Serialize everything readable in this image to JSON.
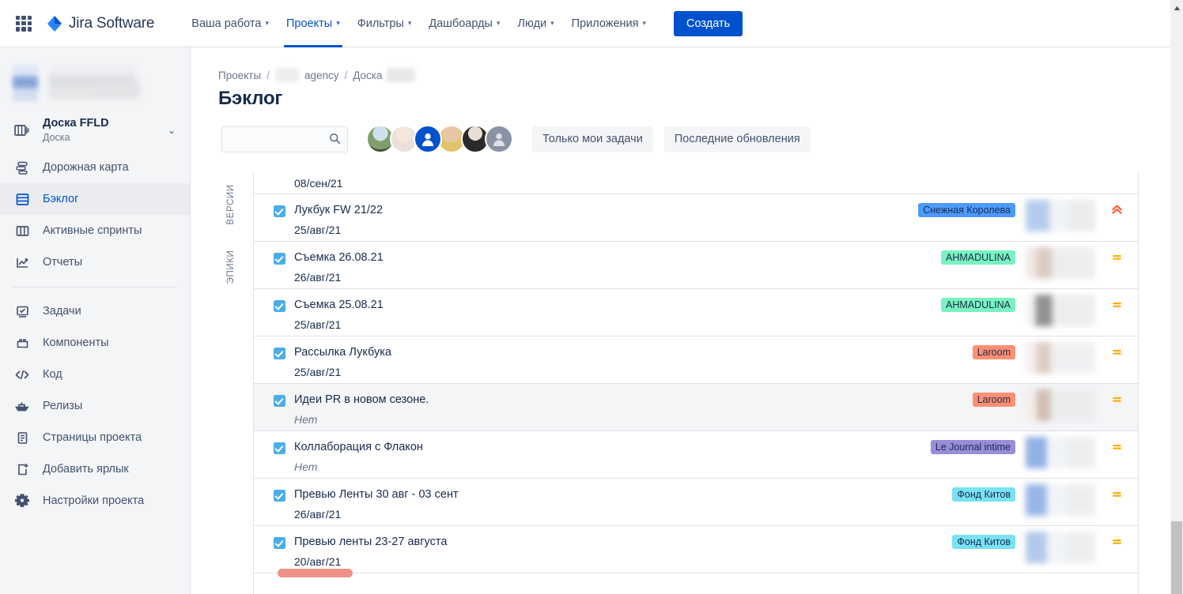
{
  "app": {
    "brand": "Jira Software",
    "apps_icon": "apps-grid-icon",
    "create_label": "Создать",
    "accent": "#0052cc"
  },
  "topnav": {
    "items": [
      {
        "label": "Ваша работа",
        "has_caret": true,
        "active": false
      },
      {
        "label": "Проекты",
        "has_caret": true,
        "active": true
      },
      {
        "label": "Фильтры",
        "has_caret": true,
        "active": false
      },
      {
        "label": "Дашбоарды",
        "has_caret": true,
        "active": false
      },
      {
        "label": "Люди",
        "has_caret": true,
        "active": false
      },
      {
        "label": "Приложения",
        "has_caret": true,
        "active": false
      }
    ]
  },
  "sidebar": {
    "board": {
      "title": "Доска FFLD",
      "subtitle": "Доска",
      "icon": "board-icon"
    },
    "items": [
      {
        "label": "Дорожная карта",
        "icon": "roadmap-icon",
        "selected": false
      },
      {
        "label": "Бэклог",
        "icon": "backlog-icon",
        "selected": true
      },
      {
        "label": "Активные спринты",
        "icon": "sprints-icon",
        "selected": false
      },
      {
        "label": "Отчеты",
        "icon": "reports-icon",
        "selected": false
      }
    ],
    "items2": [
      {
        "label": "Задачи",
        "icon": "issues-icon"
      },
      {
        "label": "Компоненты",
        "icon": "components-icon"
      },
      {
        "label": "Код",
        "icon": "code-icon"
      },
      {
        "label": "Релизы",
        "icon": "releases-icon"
      },
      {
        "label": "Страницы проекта",
        "icon": "pages-icon"
      },
      {
        "label": "Добавить ярлык",
        "icon": "add-shortcut-icon"
      },
      {
        "label": "Настройки проекта",
        "icon": "settings-gear-icon"
      }
    ]
  },
  "breadcrumb": {
    "projects": "Проекты",
    "agency": "agency",
    "board": "Доска",
    "separator": "/"
  },
  "page": {
    "title": "Бэклог"
  },
  "toolbar": {
    "search_placeholder": "",
    "search_value": "",
    "search_icon": "search-icon",
    "only_my_issues": "Только мои задачи",
    "recent_updates": "Последние обновления",
    "avatars": [
      {
        "kind": "photo",
        "tone": "#6f7d5a"
      },
      {
        "kind": "photo",
        "tone": "#e6dcd4"
      },
      {
        "kind": "glyph",
        "tone": "#0052cc",
        "selected": true
      },
      {
        "kind": "photo",
        "tone": "#d8b48e"
      },
      {
        "kind": "photo",
        "tone": "#3f3a38"
      },
      {
        "kind": "glyph",
        "tone": "#8993a4",
        "selected": false
      }
    ]
  },
  "rail": {
    "versions": "ВЕРСИИ",
    "epics": "ЭПИКИ"
  },
  "backlog": {
    "partial_top_date": "08/сен/21",
    "rows": [
      {
        "title": "Лукбук FW 21/22",
        "date": "25/авг/21",
        "date_is_none": false,
        "epic": "Снежная Королева",
        "epic_bg": "#4c9aff",
        "priority": "highest",
        "priority_color": "#ff5630",
        "alt": false,
        "blur_tone": "#a8c3ea"
      },
      {
        "title": "Съемка 26.08.21",
        "date": "26/авг/21",
        "date_is_none": false,
        "epic": "AHMADULINA",
        "epic_bg": "#79f2c0",
        "priority": "medium",
        "priority_color": "#ffab00",
        "alt": false,
        "blur_tone": "#d6c3bb"
      },
      {
        "title": "Съемка 25.08.21",
        "date": "25/авг/21",
        "date_is_none": false,
        "epic": "AHMADULINA",
        "epic_bg": "#79f2c0",
        "priority": "medium",
        "priority_color": "#ffab00",
        "alt": false,
        "blur_tone": "#7f7f7f"
      },
      {
        "title": "Рассылка Лукбука",
        "date": "25/авг/21",
        "date_is_none": false,
        "epic": "Laroom",
        "epic_bg": "#ff8f73",
        "priority": "medium",
        "priority_color": "#ffab00",
        "alt": false,
        "blur_tone": "#d8c4b8"
      },
      {
        "title": "Идеи PR в новом сезоне.",
        "date": "Нет",
        "date_is_none": true,
        "epic": "Laroom",
        "epic_bg": "#ff8f73",
        "priority": "medium",
        "priority_color": "#ffab00",
        "alt": true,
        "blur_tone": "#ccb5a8"
      },
      {
        "title": "Коллаборация с Флакон",
        "date": "Нет",
        "date_is_none": true,
        "epic": "Le Journal intime",
        "epic_bg": "#998dd9",
        "priority": "medium",
        "priority_color": "#ffab00",
        "alt": false,
        "blur_tone": "#7fa3e0"
      },
      {
        "title": "Превью Ленты 30 авг - 03 сент",
        "date": "26/авг/21",
        "date_is_none": false,
        "epic": "Фонд Китов",
        "epic_bg": "#79e2f2",
        "priority": "medium",
        "priority_color": "#ffab00",
        "alt": false,
        "blur_tone": "#87a9e4"
      },
      {
        "title": "Превью ленты 23-27 августа",
        "date": "20/авг/21",
        "date_is_none": false,
        "epic": "Фонд Китов",
        "epic_bg": "#79e2f2",
        "priority": "medium",
        "priority_color": "#ffab00",
        "alt": false,
        "blur_tone": "#a6c0e8"
      }
    ],
    "drag_pill_color": "#ee9289"
  },
  "scrollbar": {
    "up_arrow": "scroll-up-arrow-icon",
    "thumb_color": "#c1c1c1"
  }
}
